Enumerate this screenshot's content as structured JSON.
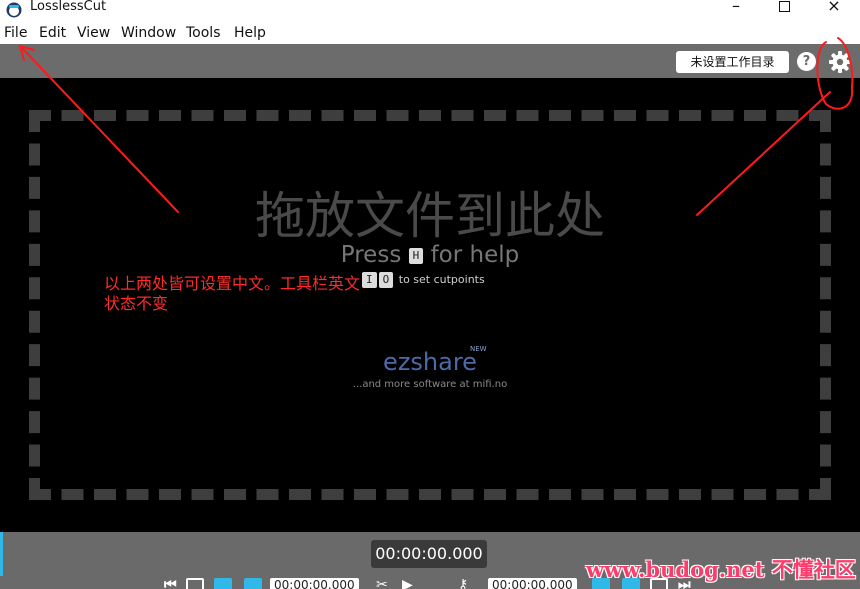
{
  "window": {
    "title": "LosslessCut",
    "minimize": "–",
    "close": "×"
  },
  "menu": {
    "items": [
      "File",
      "Edit",
      "View",
      "Window",
      "Tools",
      "Help"
    ]
  },
  "toolbar": {
    "workdir_label": "未设置工作目录",
    "help_label": "?"
  },
  "main": {
    "drop_title": "拖放文件到此处",
    "press_prefix": "Press",
    "press_key": "H",
    "press_suffix": "for help",
    "cut_keys": [
      "I",
      "O"
    ],
    "cut_text": "to set cutpoints",
    "ezshare": "ezshare",
    "ezshare_badge": "NEW",
    "more_software": "...and more software at mifi.no"
  },
  "annotation": {
    "note": "以上两处皆可设置中文。工具栏英文状态不变"
  },
  "timeline": {
    "current_time": "00:00:00.000"
  },
  "controls": {
    "cut_start_time": "00:00:00.000",
    "cut_end_time": "00:00:00.000"
  },
  "watermark": {
    "text": "www.budog.net 不懂社区"
  },
  "colors": {
    "accent": "#2fb8e8",
    "annotation_red": "#ff2a2a",
    "toolbar_gray": "#6c6c6c",
    "ezshare_blue": "#4e6aa6"
  }
}
